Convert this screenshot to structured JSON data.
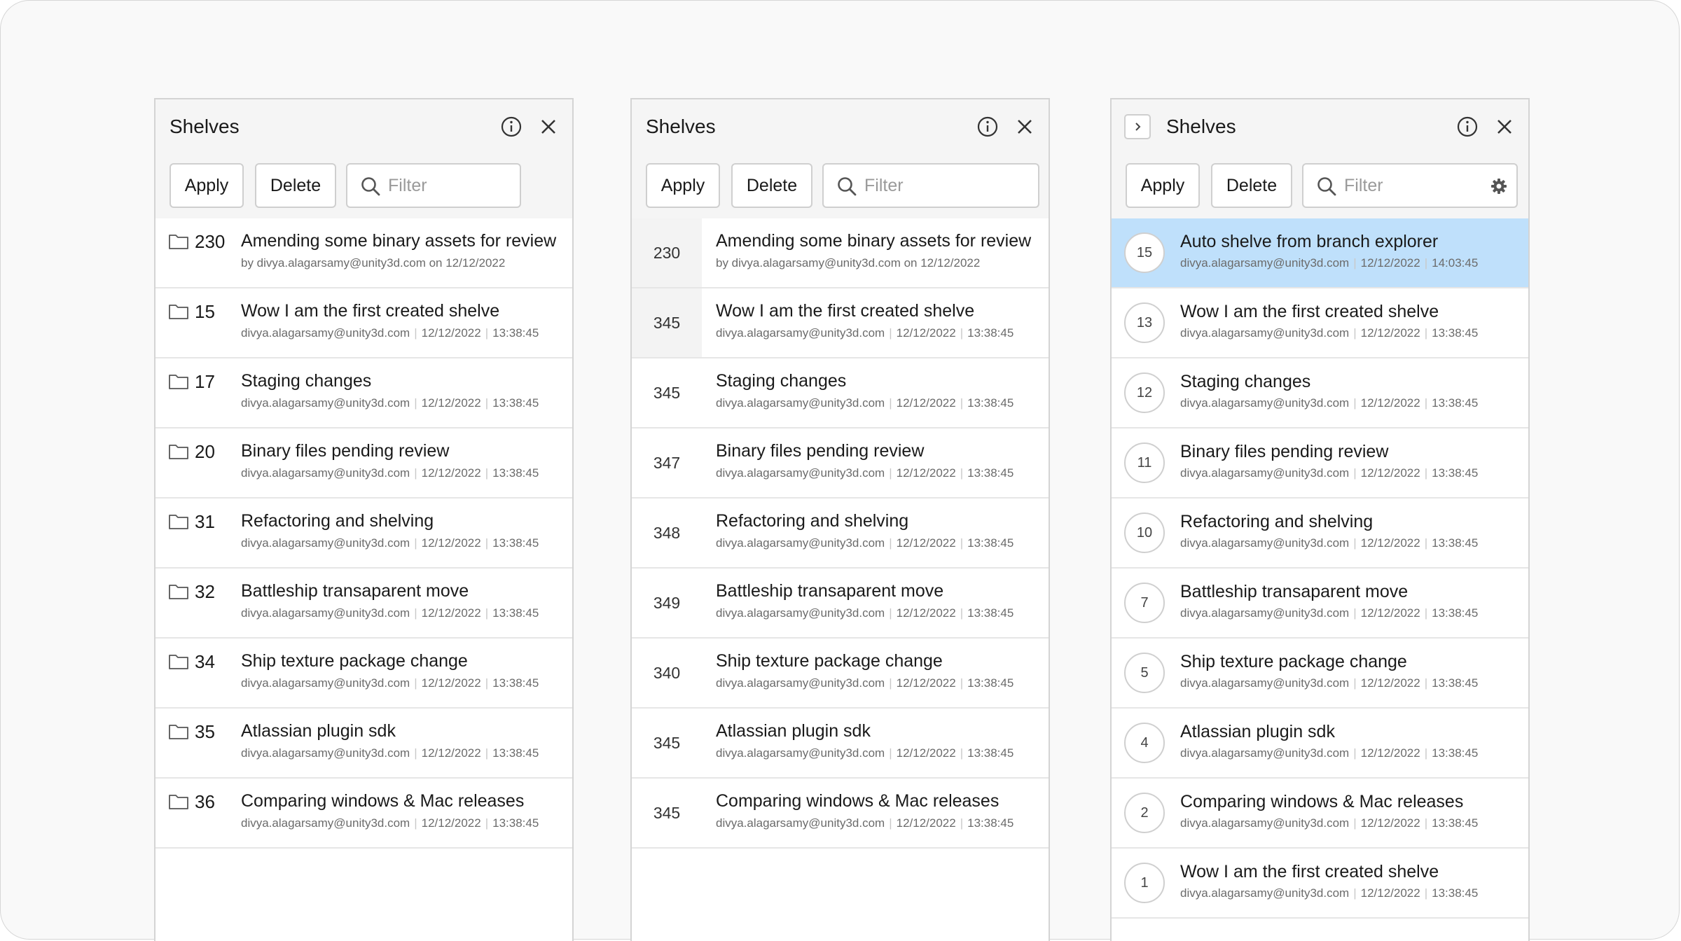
{
  "panels": [
    {
      "title": "Shelves",
      "apply_label": "Apply",
      "delete_label": "Delete",
      "filter_placeholder": "Filter",
      "rows": [
        {
          "id": "230",
          "title": "Amending some binary assets for review",
          "author": "by divya.alagarsamy@unity3d.com on 12/12/2022",
          "date": "",
          "time": ""
        },
        {
          "id": "15",
          "title": "Wow I am the first created shelve",
          "author": "divya.alagarsamy@unity3d.com",
          "date": "12/12/2022",
          "time": "13:38:45"
        },
        {
          "id": "17",
          "title": "Staging changes",
          "author": "divya.alagarsamy@unity3d.com",
          "date": "12/12/2022",
          "time": "13:38:45"
        },
        {
          "id": "20",
          "title": "Binary files pending review",
          "author": "divya.alagarsamy@unity3d.com",
          "date": "12/12/2022",
          "time": "13:38:45"
        },
        {
          "id": "31",
          "title": "Refactoring and shelving",
          "author": "divya.alagarsamy@unity3d.com",
          "date": "12/12/2022",
          "time": "13:38:45"
        },
        {
          "id": "32",
          "title": "Battleship transaparent move",
          "author": "divya.alagarsamy@unity3d.com",
          "date": "12/12/2022",
          "time": "13:38:45"
        },
        {
          "id": "34",
          "title": "Ship texture package change",
          "author": "divya.alagarsamy@unity3d.com",
          "date": "12/12/2022",
          "time": "13:38:45"
        },
        {
          "id": "35",
          "title": "Atlassian plugin sdk",
          "author": "divya.alagarsamy@unity3d.com",
          "date": "12/12/2022",
          "time": "13:38:45"
        },
        {
          "id": "36",
          "title": "Comparing windows & Mac releases",
          "author": "divya.alagarsamy@unity3d.com",
          "date": "12/12/2022",
          "time": "13:38:45"
        }
      ]
    },
    {
      "title": "Shelves",
      "apply_label": "Apply",
      "delete_label": "Delete",
      "filter_placeholder": "Filter",
      "rows": [
        {
          "id": "230",
          "title": "Amending some binary assets for review",
          "author": "by divya.alagarsamy@unity3d.com on 12/12/2022",
          "date": "",
          "time": ""
        },
        {
          "id": "345",
          "title": "Wow I am the first created shelve",
          "author": "divya.alagarsamy@unity3d.com",
          "date": "12/12/2022",
          "time": "13:38:45"
        },
        {
          "id": "345",
          "title": "Staging changes",
          "author": "divya.alagarsamy@unity3d.com",
          "date": "12/12/2022",
          "time": "13:38:45"
        },
        {
          "id": "347",
          "title": "Binary files pending review",
          "author": "divya.alagarsamy@unity3d.com",
          "date": "12/12/2022",
          "time": "13:38:45"
        },
        {
          "id": "348",
          "title": "Refactoring and shelving",
          "author": "divya.alagarsamy@unity3d.com",
          "date": "12/12/2022",
          "time": "13:38:45"
        },
        {
          "id": "349",
          "title": "Battleship transaparent move",
          "author": "divya.alagarsamy@unity3d.com",
          "date": "12/12/2022",
          "time": "13:38:45"
        },
        {
          "id": "340",
          "title": "Ship texture package change",
          "author": "divya.alagarsamy@unity3d.com",
          "date": "12/12/2022",
          "time": "13:38:45"
        },
        {
          "id": "345",
          "title": "Atlassian plugin sdk",
          "author": "divya.alagarsamy@unity3d.com",
          "date": "12/12/2022",
          "time": "13:38:45"
        },
        {
          "id": "345",
          "title": "Comparing windows & Mac releases",
          "author": "divya.alagarsamy@unity3d.com",
          "date": "12/12/2022",
          "time": "13:38:45"
        }
      ]
    },
    {
      "title": "Shelves",
      "apply_label": "Apply",
      "delete_label": "Delete",
      "filter_placeholder": "Filter",
      "rows": [
        {
          "id": "15",
          "title": "Auto shelve from branch explorer",
          "author": "divya.alagarsamy@unity3d.com",
          "date": "12/12/2022",
          "time": "14:03:45",
          "selected": true
        },
        {
          "id": "13",
          "title": "Wow I am the first created shelve",
          "author": "divya.alagarsamy@unity3d.com",
          "date": "12/12/2022",
          "time": "13:38:45"
        },
        {
          "id": "12",
          "title": "Staging changes",
          "author": "divya.alagarsamy@unity3d.com",
          "date": "12/12/2022",
          "time": "13:38:45"
        },
        {
          "id": "11",
          "title": "Binary files pending review",
          "author": "divya.alagarsamy@unity3d.com",
          "date": "12/12/2022",
          "time": "13:38:45"
        },
        {
          "id": "10",
          "title": "Refactoring and shelving",
          "author": "divya.alagarsamy@unity3d.com",
          "date": "12/12/2022",
          "time": "13:38:45"
        },
        {
          "id": "7",
          "title": "Battleship transaparent move",
          "author": "divya.alagarsamy@unity3d.com",
          "date": "12/12/2022",
          "time": "13:38:45"
        },
        {
          "id": "5",
          "title": "Ship texture package change",
          "author": "divya.alagarsamy@unity3d.com",
          "date": "12/12/2022",
          "time": "13:38:45"
        },
        {
          "id": "4",
          "title": "Atlassian plugin sdk",
          "author": "divya.alagarsamy@unity3d.com",
          "date": "12/12/2022",
          "time": "13:38:45"
        },
        {
          "id": "2",
          "title": "Comparing windows & Mac releases",
          "author": "divya.alagarsamy@unity3d.com",
          "date": "12/12/2022",
          "time": "13:38:45"
        },
        {
          "id": "1",
          "title": "Wow I am the first created shelve",
          "author": "divya.alagarsamy@unity3d.com",
          "date": "12/12/2022",
          "time": "13:38:45"
        }
      ]
    }
  ],
  "colors": {
    "selected_row": "#bfe0fb",
    "header_bg": "#f5f5f5",
    "border": "#d4d4d4"
  },
  "icons": [
    "folder-icon",
    "info-icon",
    "close-icon",
    "search-icon",
    "gear-icon",
    "chevron-right-icon"
  ]
}
